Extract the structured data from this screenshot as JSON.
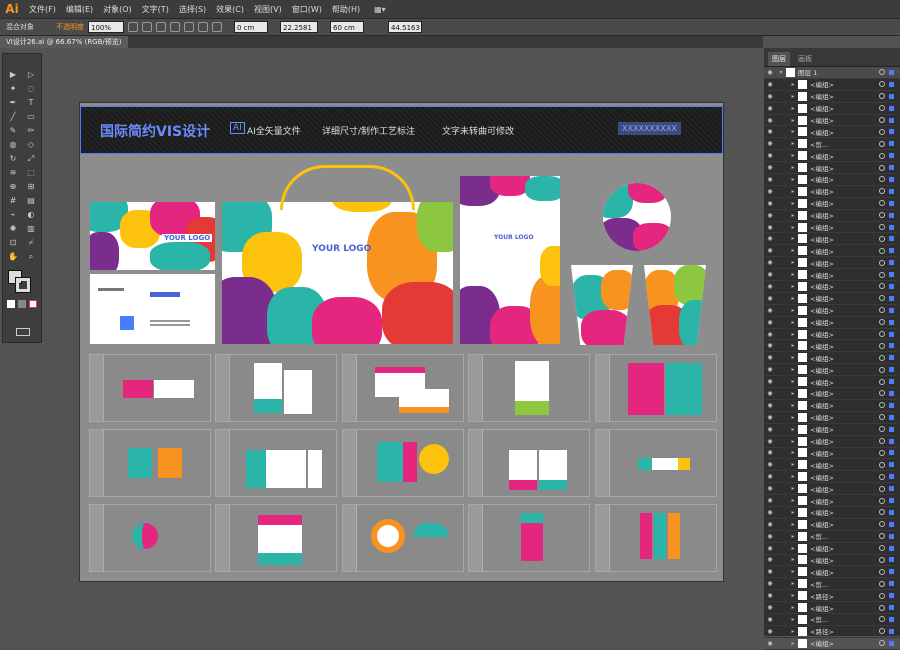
{
  "app": {
    "logo": "Ai",
    "layout_icon": "▦▾"
  },
  "menu": [
    "文件(F)",
    "编辑(E)",
    "对象(O)",
    "文字(T)",
    "选择(S)",
    "效果(C)",
    "视图(V)",
    "窗口(W)",
    "帮助(H)"
  ],
  "control_bar": {
    "object_label": "混合对象",
    "opacity_label": "不透明度",
    "opacity_value": "100%",
    "w_value": "0 cm",
    "x_value": "22.2581",
    "h_value": "60 cm",
    "y_value": "44.5163"
  },
  "document": {
    "tab": "VI设计26.ai @ 66.67% (RGB/预览)"
  },
  "panel": {
    "tabs": [
      "图层",
      "画板"
    ],
    "top_layer": "图层 1",
    "rows": [
      "<编组>",
      "<编组>",
      "<编组>",
      "<编组>",
      "<编组>",
      "<剪...",
      "<编组>",
      "<编组>",
      "<编组>",
      "<编组>",
      "<编组>",
      "<编组>",
      "<编组>",
      "<编组>",
      "<编组>",
      "<编组>",
      "<编组>",
      "<编组>",
      "<编组>",
      "<编组>",
      "<编组>",
      "<编组>",
      "<编组>",
      "<编组>",
      "<编组>",
      "<编组>",
      "<编组>",
      "<编组>",
      "<编组>",
      "<编组>",
      "<编组>",
      "<编组>",
      "<编组>",
      "<编组>",
      "<编组>",
      "<编组>",
      "<编组>",
      "<编组>",
      "<剪...",
      "<编组>",
      "<编组>",
      "<编组>",
      "<剪...",
      "<路径>",
      "<编组>",
      "<剪...",
      "<路径>",
      "<编组>"
    ]
  },
  "artwork": {
    "title": "国际简约VIS设计",
    "ai_badge": "AI",
    "feature1": "AI全矢量文件",
    "feature2": "详细尺寸/制作工艺标注",
    "feature3": "文字未转曲可修改",
    "header_right": "XXXXXXXXXX",
    "logo_text": "YOUR LOGO",
    "colors": {
      "teal": "#2bb5a8",
      "pink": "#e5267f",
      "orange": "#f7931e",
      "yellow": "#fcc20d",
      "purple": "#7b2d8e",
      "red": "#e53935",
      "green": "#8dc63f",
      "select": "#4a7cff"
    }
  }
}
